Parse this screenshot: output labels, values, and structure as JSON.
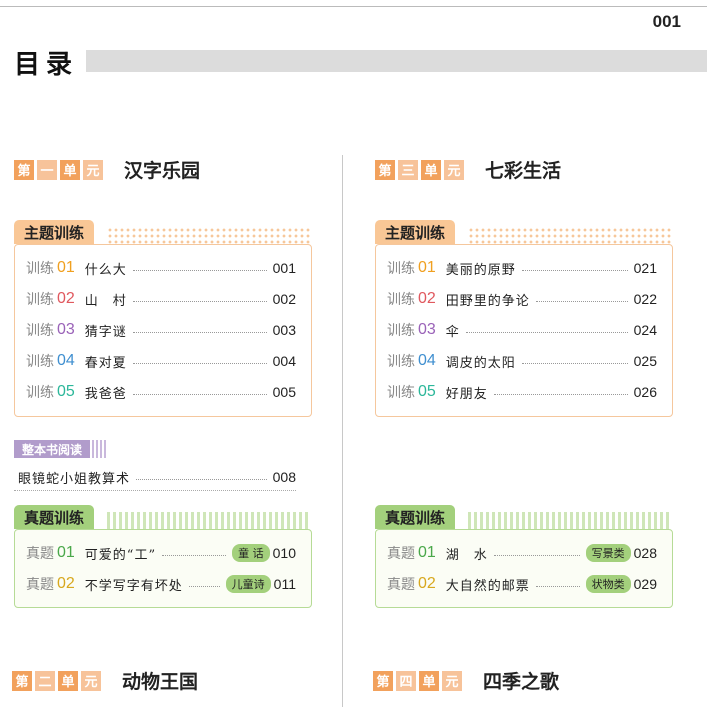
{
  "page_number": "001",
  "toc_title": "目录",
  "colors": {
    "orange": "#f2a15c",
    "green": "#a3d07c",
    "purple": "#b19ccb",
    "n1": "#f0a020",
    "n2": "#e0585e",
    "n3": "#9a62b8",
    "n4": "#3f8fd0",
    "n5": "#2cb79a",
    "z1": "#4aa84a",
    "z2": "#d8a81e"
  },
  "units": [
    {
      "chars": [
        "第",
        "一",
        "单",
        "元"
      ],
      "name": "汉字乐园",
      "theme_tab": "主题训练",
      "items": [
        {
          "label": "训练",
          "num": "01",
          "title": "什么大",
          "page": "001"
        },
        {
          "label": "训练",
          "num": "02",
          "title": "山　村",
          "page": "002"
        },
        {
          "label": "训练",
          "num": "03",
          "title": "猜字谜",
          "page": "003"
        },
        {
          "label": "训练",
          "num": "04",
          "title": "春对夏",
          "page": "004"
        },
        {
          "label": "训练",
          "num": "05",
          "title": "我爸爸",
          "page": "005"
        }
      ],
      "reading": {
        "badge": "整本书阅读",
        "title": "眼镜蛇小姐教算术",
        "page": "008"
      },
      "exam_tab": "真题训练",
      "exams": [
        {
          "label": "真题",
          "num": "01",
          "title": "可爱的“工”",
          "tag": "童 话",
          "page": "010"
        },
        {
          "label": "真题",
          "num": "02",
          "title": "不学写字有坏处",
          "tag": "儿童诗",
          "page": "011"
        }
      ]
    },
    {
      "chars": [
        "第",
        "三",
        "单",
        "元"
      ],
      "name": "七彩生活",
      "theme_tab": "主题训练",
      "items": [
        {
          "label": "训练",
          "num": "01",
          "title": "美丽的原野",
          "page": "021"
        },
        {
          "label": "训练",
          "num": "02",
          "title": "田野里的争论",
          "page": "022"
        },
        {
          "label": "训练",
          "num": "03",
          "title": "伞",
          "page": "024"
        },
        {
          "label": "训练",
          "num": "04",
          "title": "调皮的太阳",
          "page": "025"
        },
        {
          "label": "训练",
          "num": "05",
          "title": "好朋友",
          "page": "026"
        }
      ],
      "exam_tab": "真题训练",
      "exams": [
        {
          "label": "真题",
          "num": "01",
          "title": "湖　水",
          "tag": "写景类",
          "page": "028"
        },
        {
          "label": "真题",
          "num": "02",
          "title": "大自然的邮票",
          "tag": "状物类",
          "page": "029"
        }
      ]
    },
    {
      "chars": [
        "第",
        "二",
        "单",
        "元"
      ],
      "name": "动物王国"
    },
    {
      "chars": [
        "第",
        "四",
        "单",
        "元"
      ],
      "name": "四季之歌"
    }
  ]
}
